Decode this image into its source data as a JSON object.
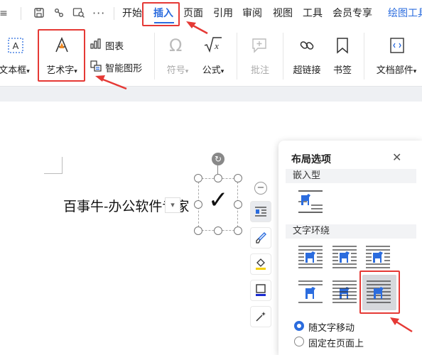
{
  "menu": {
    "items": [
      "开始",
      "插入",
      "页面",
      "引用",
      "审阅",
      "视图",
      "工具",
      "会员专享",
      "绘图工具"
    ],
    "active": "插入",
    "accent": "#2b6cde"
  },
  "ribbon": {
    "textbox_label": "文本框",
    "wordart_label": "艺术字",
    "chart_label": "图表",
    "smartart_label": "智能图形",
    "symbol_label": "符号",
    "formula_label": "公式",
    "comment_label": "批注",
    "hyperlink_label": "超链接",
    "bookmark_label": "书签",
    "docparts_label": "文档部件"
  },
  "document": {
    "text": "百事牛-办公软件专家"
  },
  "layout_panel": {
    "title": "布局选项",
    "inline_section": "嵌入型",
    "wrap_section": "文字环绕",
    "options": [
      {
        "label": "随文字移动",
        "selected": true
      },
      {
        "label": "固定在页面上",
        "selected": false
      }
    ]
  },
  "colors": {
    "highlight": "#e53935",
    "icon_blue": "#2b6cde"
  }
}
